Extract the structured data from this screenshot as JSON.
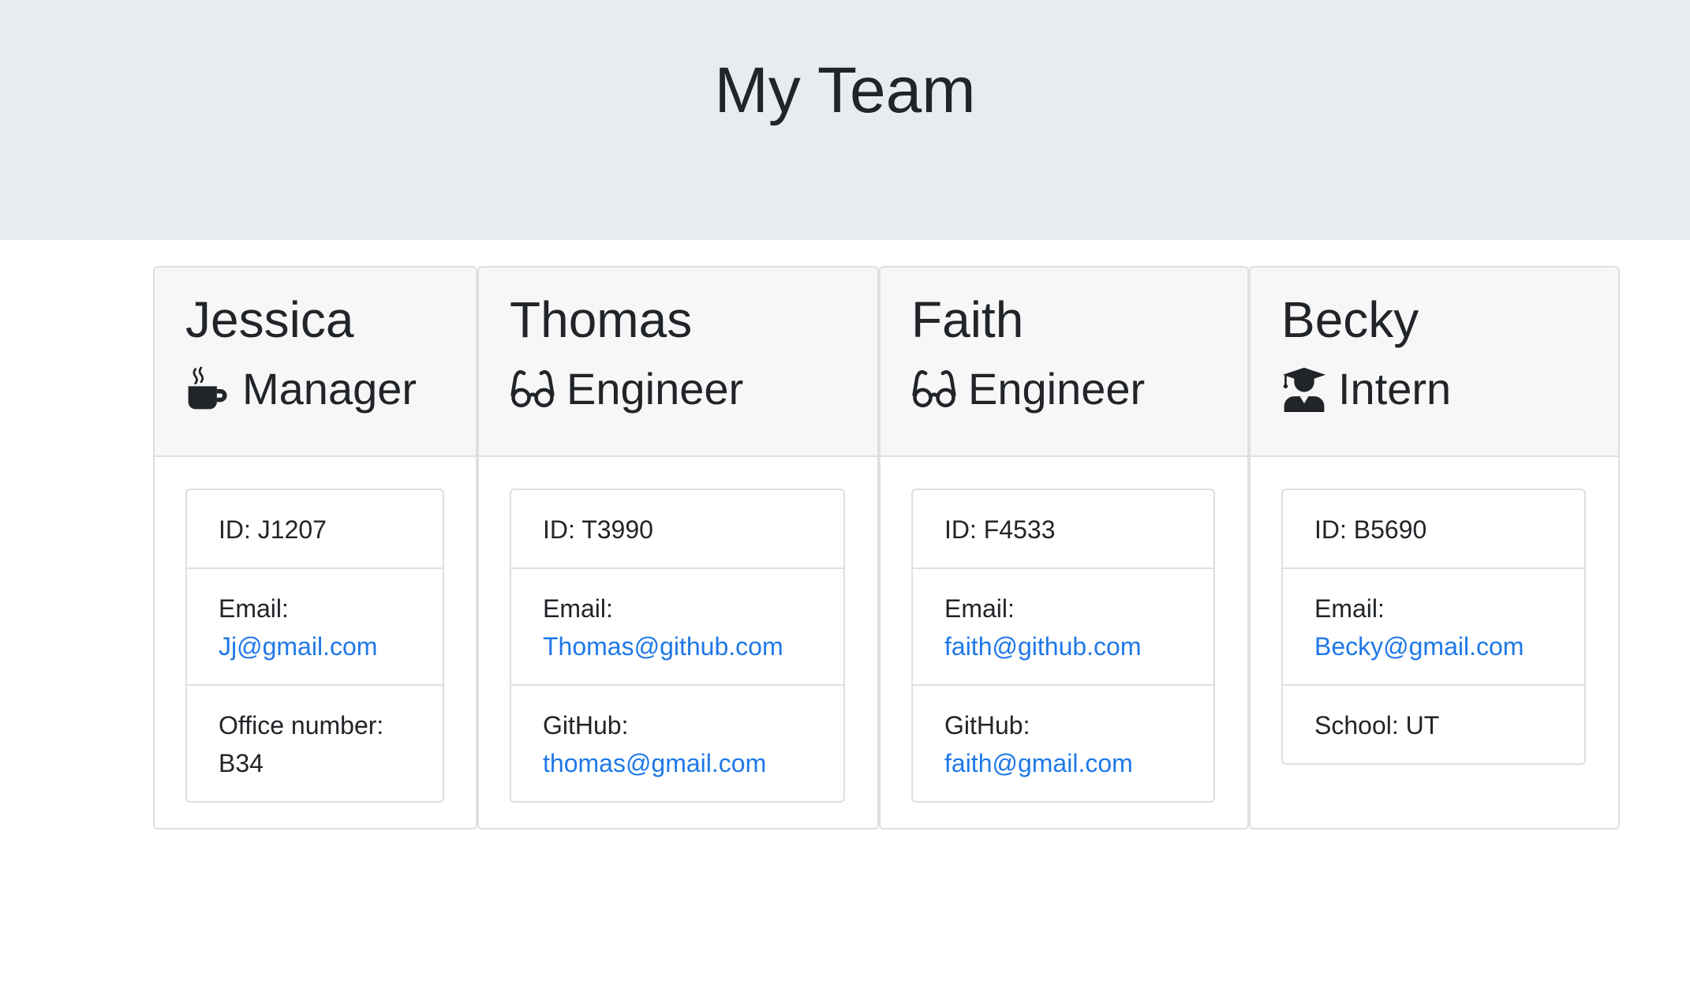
{
  "header": {
    "title": "My Team"
  },
  "team": [
    {
      "name": "Jessica",
      "role": "Manager",
      "icon": "mug-icon",
      "id_label": "ID: J1207",
      "email_label": "Email:",
      "email": "Jj@gmail.com",
      "extra_label": "Office number:",
      "extra_value": "B34"
    },
    {
      "name": "Thomas",
      "role": "Engineer",
      "icon": "glasses-icon",
      "id_label": "ID: T3990",
      "email_label": "Email:",
      "email": "Thomas@github.com",
      "extra_label": "GitHub:",
      "extra_value": "thomas@gmail.com"
    },
    {
      "name": "Faith",
      "role": "Engineer",
      "icon": "glasses-icon",
      "id_label": "ID: F4533",
      "email_label": "Email:",
      "email": "faith@github.com",
      "extra_label": "GitHub:",
      "extra_value": "faith@gmail.com"
    },
    {
      "name": "Becky",
      "role": "Intern",
      "icon": "graduate-icon",
      "id_label": "ID: B5690",
      "email_label": "Email:",
      "email": "Becky@gmail.com",
      "extra_label": "School: UT"
    }
  ],
  "colors": {
    "header_bg": "#e9ecef",
    "link": "#1f78e8",
    "card_header_bg": "#f7f7f7",
    "border": "#dfdfdf",
    "text": "#212529"
  }
}
